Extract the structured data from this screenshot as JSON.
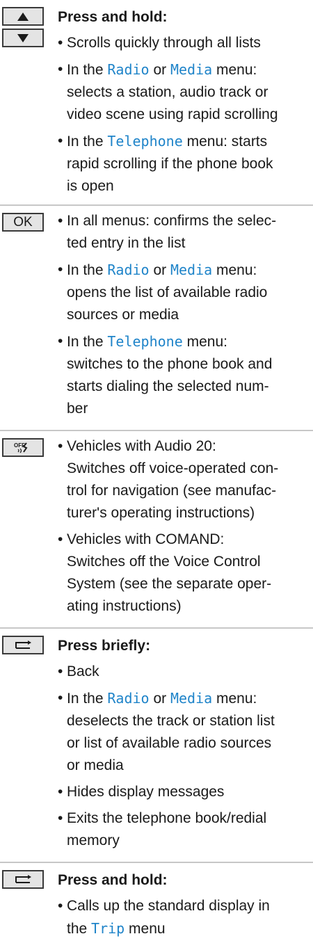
{
  "rows": [
    {
      "keys": [
        {
          "name": "up-arrow-key-icon",
          "glyph": "▲"
        },
        {
          "name": "down-arrow-key-icon",
          "glyph": "▼"
        }
      ],
      "heading": "Press and hold:",
      "items": [
        {
          "lines": [
            "Scrolls quickly through all lists"
          ]
        },
        {
          "pre": "In the ",
          "hl1": "Radio",
          "mid": " or ",
          "hl2": "Media",
          "post": " menu:",
          "rest": [
            "selects a station, audio track or",
            "video scene using rapid scrolling"
          ]
        },
        {
          "pre": "In the ",
          "hl1": "Telephone",
          "post": " menu: starts",
          "rest": [
            "rapid scrolling if the phone book",
            "is open"
          ]
        }
      ]
    },
    {
      "keys": [
        {
          "name": "ok-key-icon",
          "glyph": "OK"
        }
      ],
      "items": [
        {
          "lines": [
            "In all menus: confirms the selec-",
            "ted entry in the list"
          ]
        },
        {
          "pre": "In the ",
          "hl1": "Radio",
          "mid": " or ",
          "hl2": "Media",
          "post": " menu:",
          "rest": [
            "opens the list of available radio",
            "sources or media"
          ]
        },
        {
          "pre": "In the ",
          "hl1": "Telephone",
          "post": " menu:",
          "rest": [
            "switches to the phone book and",
            "starts dialing the selected num-",
            "ber"
          ]
        }
      ]
    },
    {
      "keys": [
        {
          "name": "voice-control-off-key-icon",
          "glyph": "OFF"
        }
      ],
      "items": [
        {
          "lines": [
            "Vehicles with Audio 20:",
            "Switches off voice-operated con-",
            "trol for navigation (see manufac-",
            "turer's operating instructions)"
          ]
        },
        {
          "lines": [
            "Vehicles with COMAND:",
            "Switches off the Voice Control",
            "System (see the separate oper-",
            "ating instructions)"
          ]
        }
      ]
    },
    {
      "keys": [
        {
          "name": "back-key-icon",
          "glyph": "back"
        }
      ],
      "heading": "Press briefly:",
      "items": [
        {
          "lines": [
            "Back"
          ]
        },
        {
          "pre": "In the ",
          "hl1": "Radio",
          "mid": " or ",
          "hl2": "Media",
          "post": " menu:",
          "rest": [
            "deselects the track or station list",
            "or list of available radio sources",
            "or media"
          ]
        },
        {
          "lines": [
            "Hides display messages"
          ]
        },
        {
          "lines": [
            "Exits the telephone book/redial",
            "memory"
          ]
        }
      ]
    },
    {
      "keys": [
        {
          "name": "back-key-icon",
          "glyph": "back"
        }
      ],
      "heading": "Press and hold:",
      "items": [
        {
          "lines": [
            "Calls up the standard display in"
          ],
          "pre2": "the ",
          "hl1": "Trip",
          "post": " menu"
        }
      ]
    }
  ]
}
